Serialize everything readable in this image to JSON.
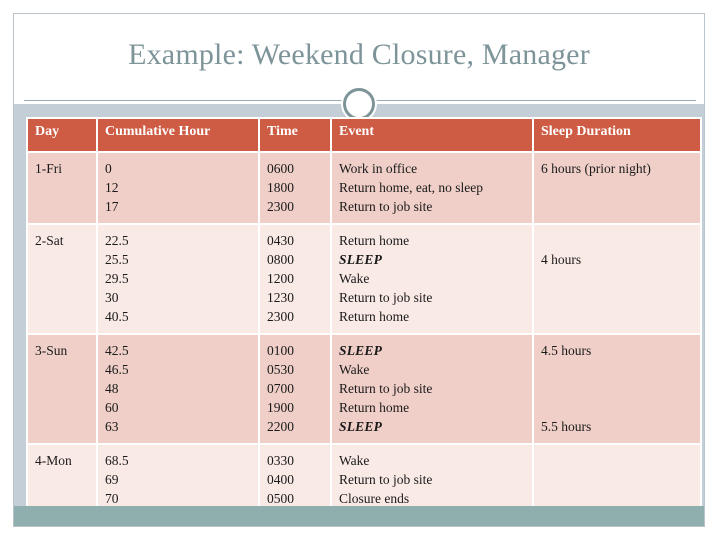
{
  "slide": {
    "title": "Example: Weekend Closure, Manager",
    "ornament_icon": "circle-ring-ornament",
    "colors": {
      "title_text": "#7d9499",
      "body_background": "#c3ced6",
      "footer_bar": "#8fafae",
      "table_header": "#ce5b43",
      "row_dark": "#efcfc8",
      "row_light": "#faeae6",
      "slide_border": "#b9c3c9"
    }
  },
  "table": {
    "columns": [
      "Day",
      "Cumulative Hour",
      "Time",
      "Event",
      "Sleep Duration"
    ],
    "rows": [
      {
        "day": "1-Fri",
        "shade": "dark",
        "cumulative_hours": [
          "0",
          "12",
          "17"
        ],
        "times": [
          "0600",
          "1800",
          "2300"
        ],
        "events": [
          {
            "text": "Work in office",
            "emphasis": false
          },
          {
            "text": "Return home, eat, no sleep",
            "emphasis": false
          },
          {
            "text": "Return to job site",
            "emphasis": false
          }
        ],
        "sleep_duration": [
          "6 hours (prior night)",
          "",
          ""
        ]
      },
      {
        "day": "2-Sat",
        "shade": "light",
        "cumulative_hours": [
          "22.5",
          "25.5",
          "29.5",
          "30",
          "40.5"
        ],
        "times": [
          "0430",
          "0800",
          "1200",
          "1230",
          "2300"
        ],
        "events": [
          {
            "text": "Return home",
            "emphasis": false
          },
          {
            "text": "SLEEP",
            "emphasis": true
          },
          {
            "text": "Wake",
            "emphasis": false
          },
          {
            "text": "Return to job site",
            "emphasis": false
          },
          {
            "text": "Return home",
            "emphasis": false
          }
        ],
        "sleep_duration": [
          "",
          "4 hours",
          "",
          "",
          ""
        ]
      },
      {
        "day": "3-Sun",
        "shade": "dark",
        "cumulative_hours": [
          "42.5",
          "46.5",
          "48",
          "60",
          "63"
        ],
        "times": [
          "0100",
          "0530",
          "0700",
          "1900",
          "2200"
        ],
        "events": [
          {
            "text": "SLEEP",
            "emphasis": true
          },
          {
            "text": "Wake",
            "emphasis": false
          },
          {
            "text": "Return to job site",
            "emphasis": false
          },
          {
            "text": "Return home",
            "emphasis": false
          },
          {
            "text": "SLEEP",
            "emphasis": true
          }
        ],
        "sleep_duration": [
          "4.5 hours",
          "",
          "",
          "",
          "5.5 hours"
        ]
      },
      {
        "day": "4-Mon",
        "shade": "light",
        "cumulative_hours": [
          "68.5",
          "69",
          "70"
        ],
        "times": [
          "0330",
          "0400",
          "0500"
        ],
        "events": [
          {
            "text": "Wake",
            "emphasis": false
          },
          {
            "text": "Return to job site",
            "emphasis": false
          },
          {
            "text": "Closure ends",
            "emphasis": false
          }
        ],
        "sleep_duration": [
          "",
          "",
          ""
        ]
      }
    ]
  }
}
